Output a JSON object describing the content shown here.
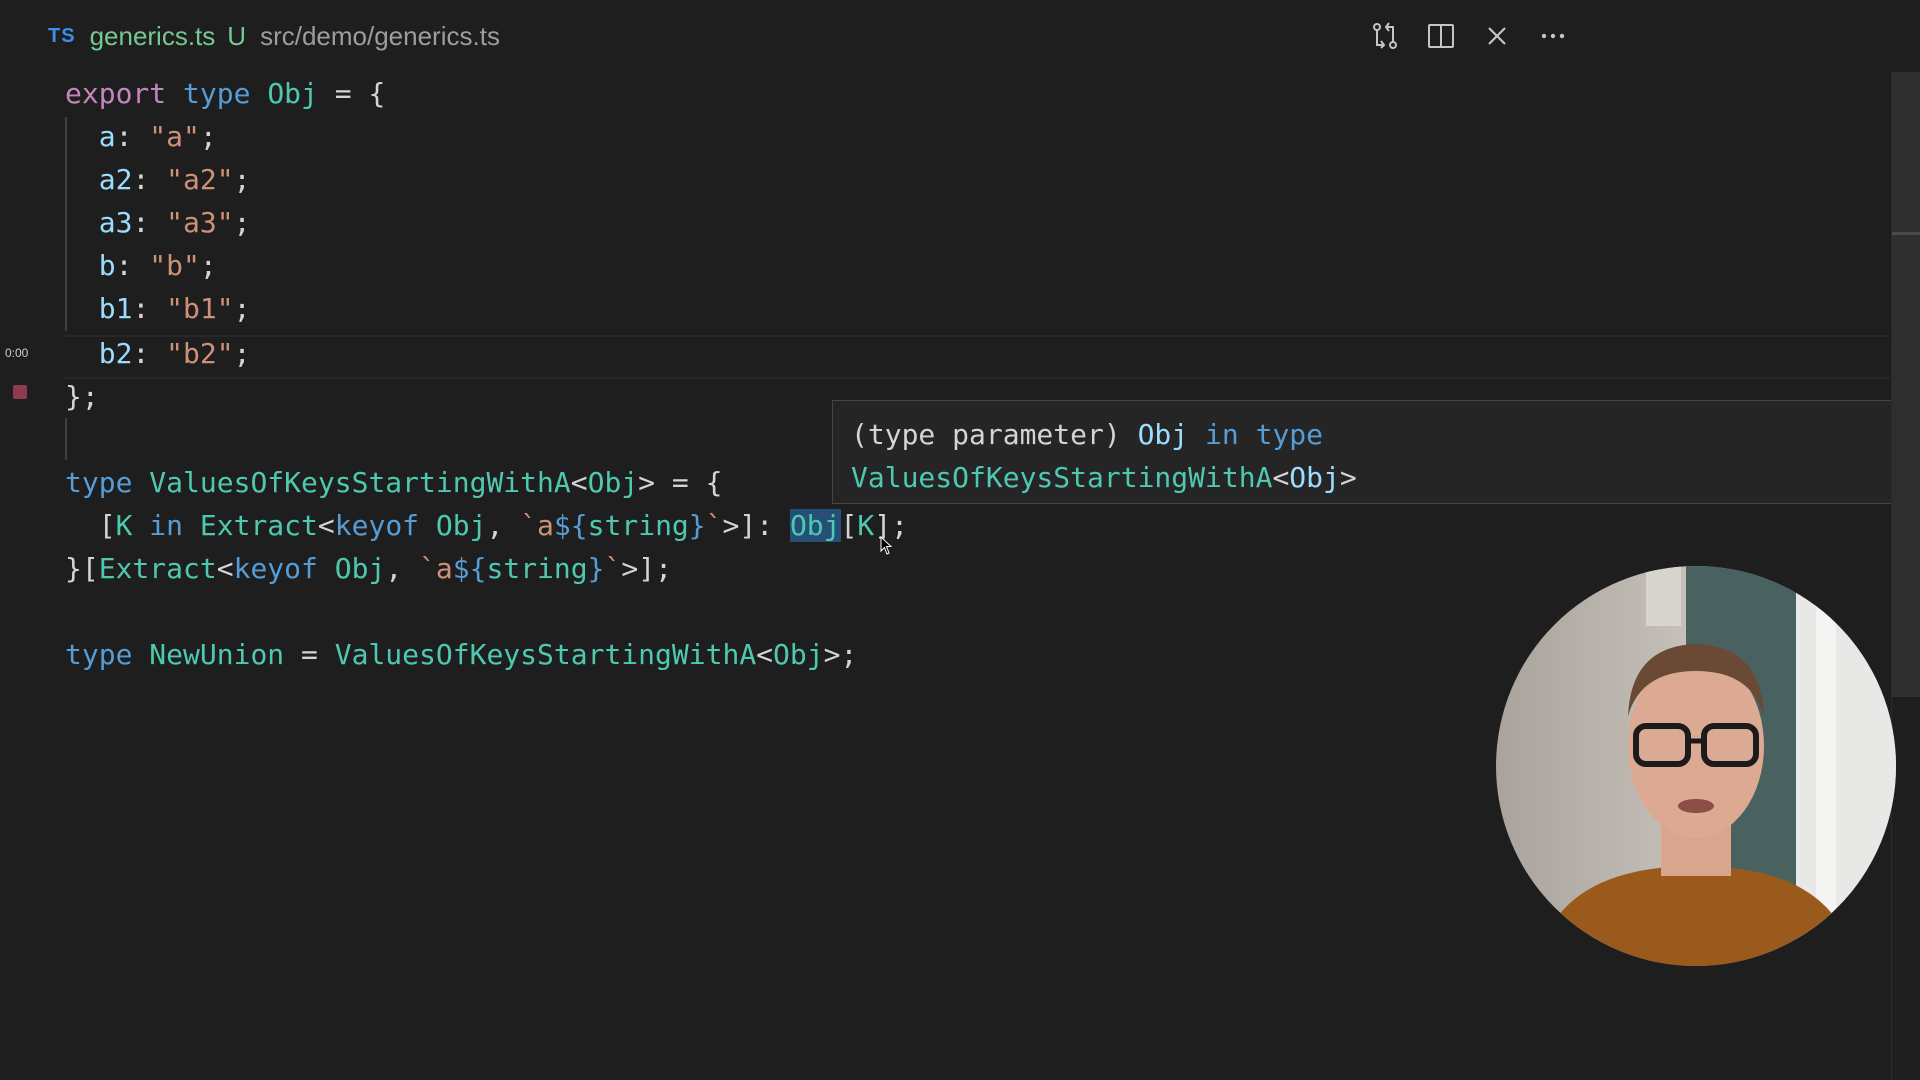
{
  "tab": {
    "badge": "TS",
    "filename": "generics.ts",
    "status": "U",
    "path": "src/demo/generics.ts"
  },
  "actions": [
    {
      "name": "open-changes-icon"
    },
    {
      "name": "split-editor-icon"
    },
    {
      "name": "close-icon"
    },
    {
      "name": "more-actions-icon"
    }
  ],
  "gutter": {
    "timestamp": "0:00"
  },
  "code": {
    "l1": {
      "a": "export",
      "b": "type",
      "c": "Obj",
      "d": " = {"
    },
    "l2": {
      "a": "a",
      "b": ": ",
      "c": "\"a\"",
      "d": ";"
    },
    "l3": {
      "a": "a2",
      "b": ": ",
      "c": "\"a2\"",
      "d": ";"
    },
    "l4": {
      "a": "a3",
      "b": ": ",
      "c": "\"a3\"",
      "d": ";"
    },
    "l5": {
      "a": "b",
      "b": ": ",
      "c": "\"b\"",
      "d": ";"
    },
    "l6": {
      "a": "b1",
      "b": ": ",
      "c": "\"b1\"",
      "d": ";"
    },
    "l7": {
      "a": "b2",
      "b": ": ",
      "c": "\"b2\"",
      "d": ";"
    },
    "l8": {
      "a": "};"
    },
    "l10": {
      "a": "type",
      "b": "ValuesOfKeysStartingWithA",
      "c": "<",
      "d": "Obj",
      "e": "> = {"
    },
    "l11": {
      "a": "[",
      "b": "K",
      "c": "in",
      "d": "Extract",
      "e": "<",
      "f": "keyof",
      "g": "Obj",
      "h": ", ",
      "i": "`a",
      "j": "${",
      "k": "string",
      "l": "}",
      "m": "`",
      "n": ">]: ",
      "o": "Obj",
      "p": "[",
      "q": "K",
      "r": "];"
    },
    "l12": {
      "a": "}[",
      "b": "Extract",
      "c": "<",
      "d": "keyof",
      "e": "Obj",
      "f": ", ",
      "g": "`a",
      "h": "${",
      "i": "string",
      "j": "}",
      "k": "`",
      "l": ">];"
    },
    "l14": {
      "a": "type",
      "b": "NewUnion",
      "c": " = ",
      "d": "ValuesOfKeysStartingWithA",
      "e": "<",
      "f": "Obj",
      "g": ">;"
    }
  },
  "hover": {
    "r1a": "(type parameter) ",
    "r1b": "Obj",
    "r1c": "in",
    "r1d": "type",
    "r2a": "ValuesOfKeysStartingWithA",
    "r2b": "<",
    "r2c": "Obj",
    "r2d": ">"
  },
  "colors": {
    "background": "#1e1e1e",
    "keyword_control": "#c586c0",
    "keyword": "#569cd6",
    "type": "#4ec9b0",
    "property": "#9cdcfe",
    "string": "#ce9178",
    "git_untracked": "#73c991"
  }
}
